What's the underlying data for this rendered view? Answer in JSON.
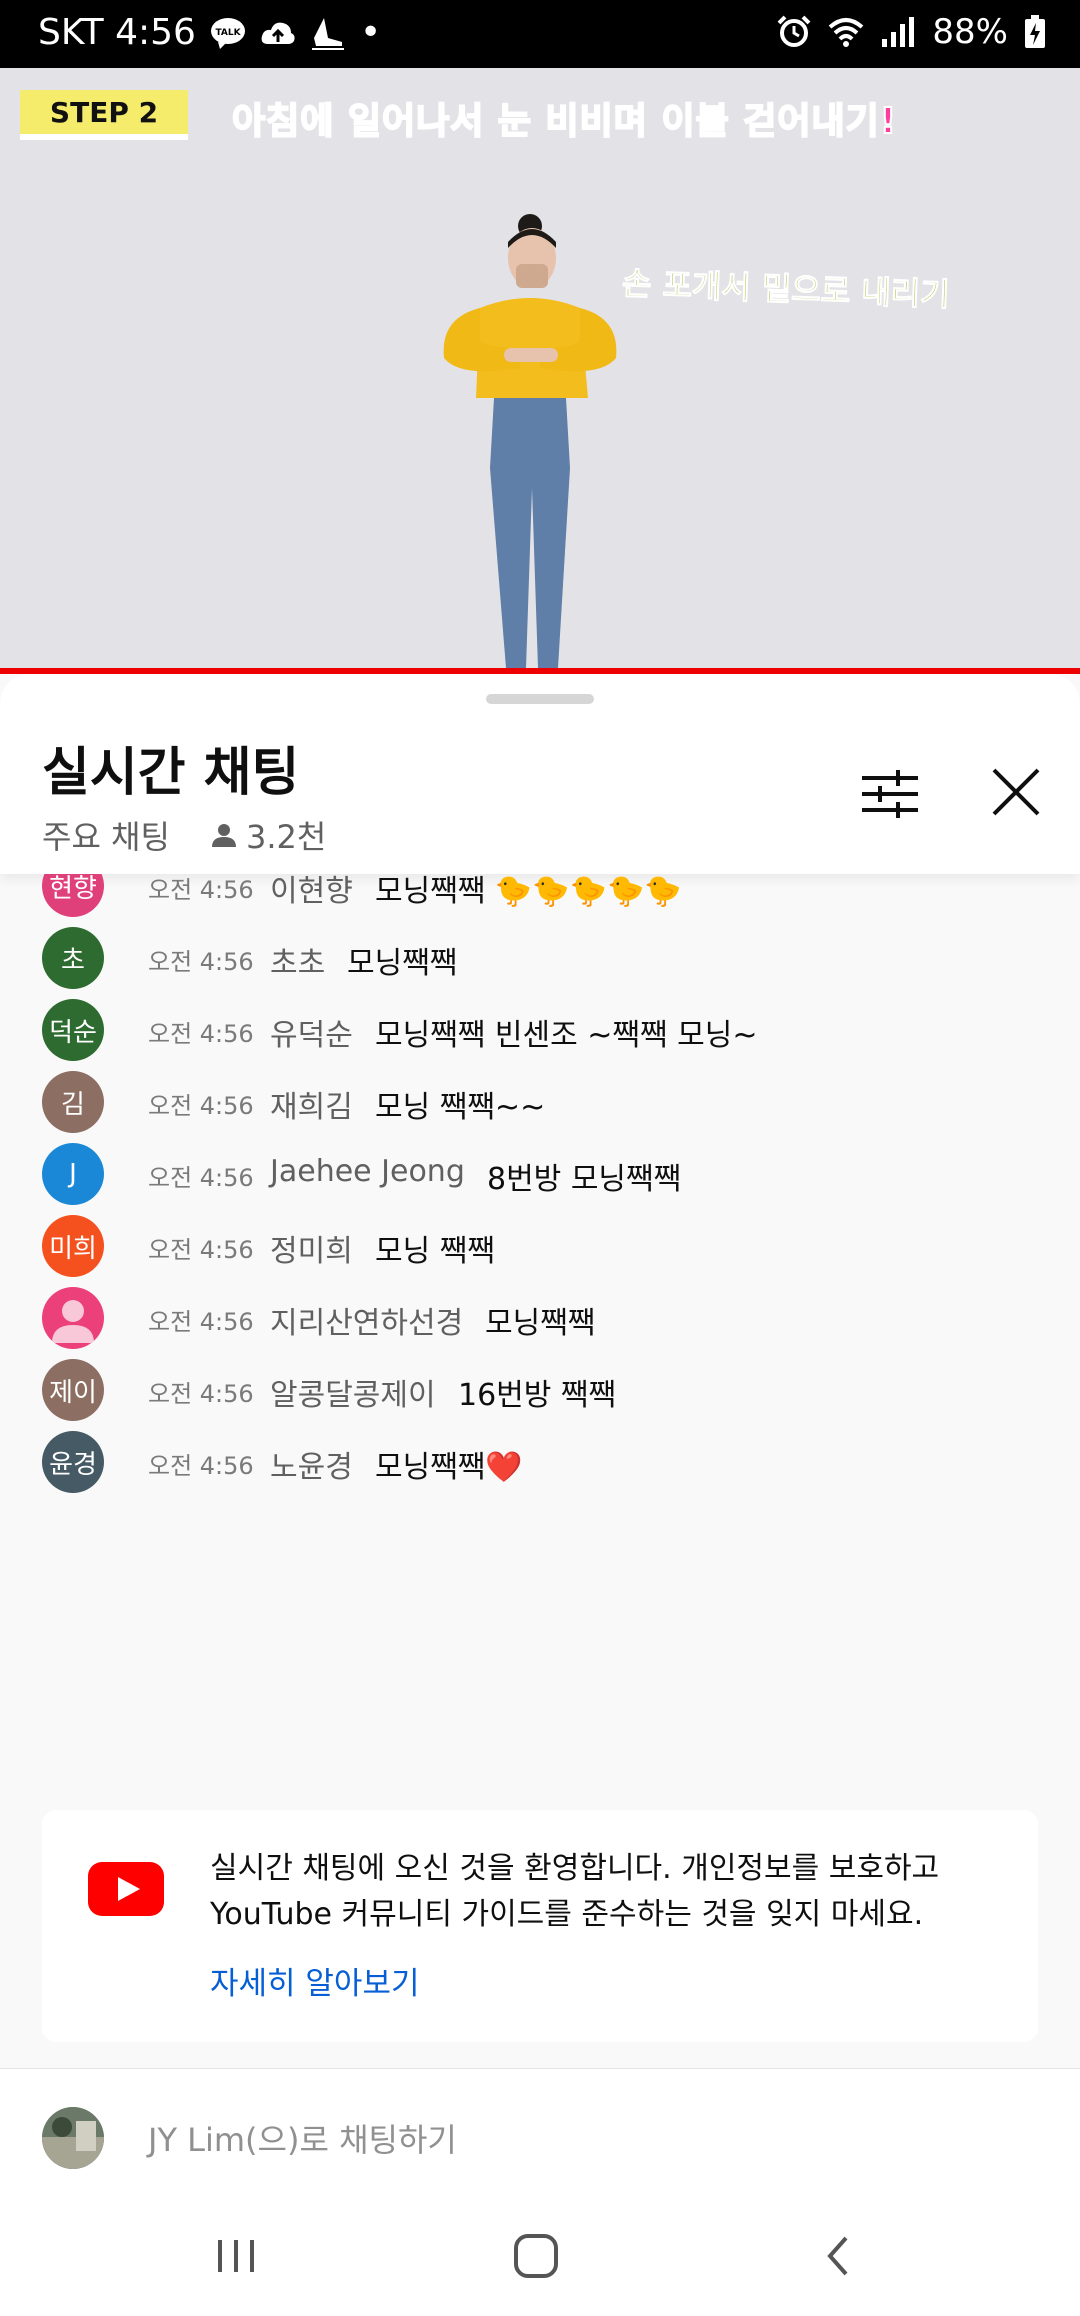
{
  "status_bar": {
    "carrier_time": "SKT 4:56",
    "dot": "•",
    "battery": "88%"
  },
  "video": {
    "step_label": "STEP 2",
    "caption": "아침에 일어나서 눈 비비며 이불 걷어내기!",
    "subcaption": "손 포개서 밑으로 내리기"
  },
  "chat": {
    "title": "실시간 채팅",
    "mode": "주요 채팅",
    "viewers": "3.2천",
    "messages": [
      {
        "avatar": "현향",
        "color": "#e0407a",
        "time": "오전 4:56",
        "author": "이현향",
        "text": "모닝짹짹 🐤🐤🐤🐤🐤"
      },
      {
        "avatar": "초",
        "color": "#2e6b30",
        "time": "오전 4:56",
        "author": "초초",
        "text": "모닝짹짹"
      },
      {
        "avatar": "덕순",
        "color": "#2e6b30",
        "time": "오전 4:56",
        "author": "유덕순",
        "text": "모닝짹짹 빈센조 ~짹짹 모닝~"
      },
      {
        "avatar": "김",
        "color": "#8d6e63",
        "time": "오전 4:56",
        "author": "재희김",
        "text": "모닝 짹짹~~"
      },
      {
        "avatar": "J",
        "color": "#1a88d6",
        "time": "오전 4:56",
        "author": "Jaehee Jeong",
        "text": "8번방 모닝짹짹"
      },
      {
        "avatar": "미희",
        "color": "#f4511e",
        "time": "오전 4:56",
        "author": "정미희",
        "text": "모닝 짹짹"
      },
      {
        "avatar": "",
        "color": "#ec407a",
        "time": "오전 4:56",
        "author": "지리산연하선경",
        "text": "모닝짹짹"
      },
      {
        "avatar": "제이",
        "color": "#8d6e63",
        "time": "오전 4:56",
        "author": "알콩달콩제이",
        "text": "16번방 짹짹"
      },
      {
        "avatar": "윤경",
        "color": "#455a64",
        "time": "오전 4:56",
        "author": "노윤경",
        "text": "모닝짹짹❤️"
      }
    ],
    "welcome_text": "실시간 채팅에 오신 것을 환영합니다. 개인정보를 보호하고 YouTube 커뮤니티 가이드를 준수하는 것을 잊지 마세요.",
    "learn_more": "자세히 알아보기",
    "input_placeholder": "JY Lim(으)로 채팅하기"
  }
}
